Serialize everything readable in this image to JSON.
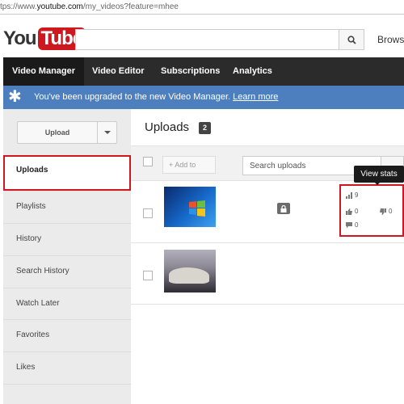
{
  "browser": {
    "url_prefix": "tps://www.",
    "url_domain": "youtube.com",
    "url_suffix": "/my_videos?feature=mhee"
  },
  "header": {
    "logo_you": "You",
    "logo_tube": "Tube",
    "search_placeholder": "",
    "browse_label": "Browse"
  },
  "nav": {
    "tabs": [
      {
        "label": "Video Manager",
        "active": true
      },
      {
        "label": "Video Editor"
      },
      {
        "label": "Subscriptions"
      },
      {
        "label": "Analytics"
      }
    ]
  },
  "banner": {
    "text": "You've been upgraded to the new Video Manager.",
    "link": "Learn more"
  },
  "sidebar": {
    "upload_label": "Upload",
    "items": [
      {
        "label": "Uploads",
        "active": true
      },
      {
        "label": "Playlists"
      },
      {
        "label": "History"
      },
      {
        "label": "Search History"
      },
      {
        "label": "Watch Later"
      },
      {
        "label": "Favorites"
      },
      {
        "label": "Likes"
      }
    ]
  },
  "main": {
    "title": "Uploads",
    "count": "2",
    "toolbar": {
      "add_to_label": "+ Add to",
      "search_placeholder": "Search uploads"
    },
    "videos": [
      {
        "thumbnail": "windows-desktop",
        "privacy": "private",
        "views": "9",
        "likes": "0",
        "dislikes": "0",
        "comments": "0"
      },
      {
        "thumbnail": "seal-on-rock"
      }
    ],
    "tooltip": "View stats"
  },
  "colors": {
    "brand_red": "#cc181e",
    "nav_bg": "#2b2b2b",
    "banner_blue": "#4d7fbf"
  }
}
